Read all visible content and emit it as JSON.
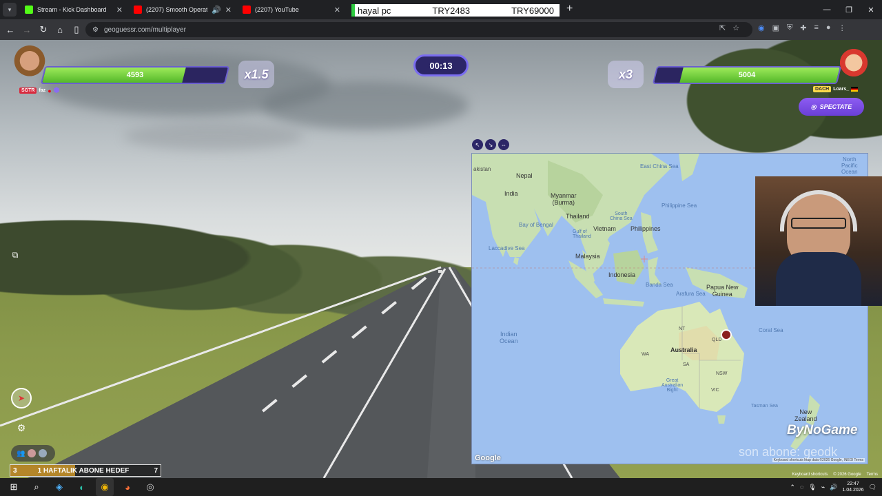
{
  "browser": {
    "tabs": [
      {
        "title": "Stream - Kick Dashboard",
        "color": "#53fc18"
      },
      {
        "title": "(2207) Smooth Operator (S",
        "color": "#ff0000"
      },
      {
        "title": "(2207) YouTube",
        "color": "#ff0000"
      }
    ],
    "ticker": {
      "label": "hayal pc",
      "current": "TRY2483",
      "target": "TRY69000"
    },
    "url": "geoguessr.com/multiplayer"
  },
  "game": {
    "timer": "00:13",
    "player_left": {
      "health": "4593",
      "health_fraction": 0.77,
      "multiplier": "x1.5",
      "tag": "SGTR",
      "name": "faz"
    },
    "player_right": {
      "health": "5004",
      "health_fraction": 0.86,
      "multiplier": "x3",
      "tag": "DACH",
      "name": "Loars_"
    },
    "spectate_label": "SPECTATE"
  },
  "map": {
    "labels": {
      "nepal": "Nepal",
      "india": "India",
      "myanmar": "Myanmar\n(Burma)",
      "thailand": "Thailand",
      "vietnam": "Vietnam",
      "philippines": "Philippines",
      "philippine_sea": "Philippine Sea",
      "east_china_sea": "East China Sea",
      "north_pacific": "North\nPacific\nOcean",
      "bay_of_bengal": "Bay of Bengal",
      "laccadive": "Laccadive Sea",
      "south_china_sea": "South\nChina Sea",
      "gulf_thailand": "Gulf of\nThailand",
      "malaysia": "Malaysia",
      "indonesia": "Indonesia",
      "banda_sea": "Banda Sea",
      "arafura_sea": "Arafura Sea",
      "papua": "Papua New\nGuinea",
      "coral_sea": "Coral Sea",
      "indian_ocean": "Indian\nOcean",
      "australia": "Australia",
      "nt": "NT",
      "qld": "QLD",
      "wa": "WA",
      "sa": "SA",
      "nsw": "NSW",
      "vic": "VIC",
      "great_bight": "Great\nAustralian\nBight",
      "tasman": "Tasman Sea",
      "new_zealand": "New\nZealand",
      "pakistan": "akistan"
    },
    "attribution": "Google",
    "footer": "Keyboard shortcuts   Map data ©2026 Google, INEGI   Terms"
  },
  "overlay": {
    "brand": "ByNoGame",
    "last_sub": "son abone: geodk",
    "goal_label": "1 HAFTALIK ABONE HEDEF",
    "goal_current": "3",
    "goal_target": "7",
    "goal_fraction": 0.43
  },
  "streetview_footer": {
    "shortcuts": "Keyboard shortcuts",
    "copyright": "© 2026 Google",
    "terms": "Terms"
  },
  "taskbar": {
    "time": "22:47",
    "date": "1.04.2026"
  }
}
